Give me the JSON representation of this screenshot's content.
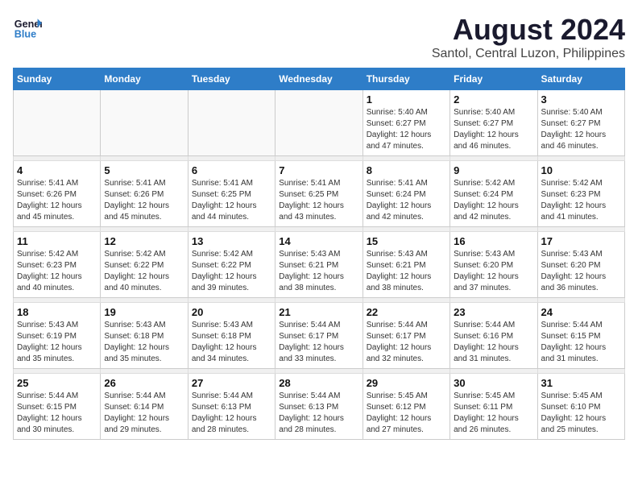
{
  "logo": {
    "line1": "General",
    "line2": "Blue"
  },
  "title": "August 2024",
  "subtitle": "Santol, Central Luzon, Philippines",
  "days_of_week": [
    "Sunday",
    "Monday",
    "Tuesday",
    "Wednesday",
    "Thursday",
    "Friday",
    "Saturday"
  ],
  "weeks": [
    {
      "days": [
        {
          "date": "",
          "info": ""
        },
        {
          "date": "",
          "info": ""
        },
        {
          "date": "",
          "info": ""
        },
        {
          "date": "",
          "info": ""
        },
        {
          "date": "1",
          "info": "Sunrise: 5:40 AM\nSunset: 6:27 PM\nDaylight: 12 hours\nand 47 minutes."
        },
        {
          "date": "2",
          "info": "Sunrise: 5:40 AM\nSunset: 6:27 PM\nDaylight: 12 hours\nand 46 minutes."
        },
        {
          "date": "3",
          "info": "Sunrise: 5:40 AM\nSunset: 6:27 PM\nDaylight: 12 hours\nand 46 minutes."
        }
      ]
    },
    {
      "days": [
        {
          "date": "4",
          "info": "Sunrise: 5:41 AM\nSunset: 6:26 PM\nDaylight: 12 hours\nand 45 minutes."
        },
        {
          "date": "5",
          "info": "Sunrise: 5:41 AM\nSunset: 6:26 PM\nDaylight: 12 hours\nand 45 minutes."
        },
        {
          "date": "6",
          "info": "Sunrise: 5:41 AM\nSunset: 6:25 PM\nDaylight: 12 hours\nand 44 minutes."
        },
        {
          "date": "7",
          "info": "Sunrise: 5:41 AM\nSunset: 6:25 PM\nDaylight: 12 hours\nand 43 minutes."
        },
        {
          "date": "8",
          "info": "Sunrise: 5:41 AM\nSunset: 6:24 PM\nDaylight: 12 hours\nand 42 minutes."
        },
        {
          "date": "9",
          "info": "Sunrise: 5:42 AM\nSunset: 6:24 PM\nDaylight: 12 hours\nand 42 minutes."
        },
        {
          "date": "10",
          "info": "Sunrise: 5:42 AM\nSunset: 6:23 PM\nDaylight: 12 hours\nand 41 minutes."
        }
      ]
    },
    {
      "days": [
        {
          "date": "11",
          "info": "Sunrise: 5:42 AM\nSunset: 6:23 PM\nDaylight: 12 hours\nand 40 minutes."
        },
        {
          "date": "12",
          "info": "Sunrise: 5:42 AM\nSunset: 6:22 PM\nDaylight: 12 hours\nand 40 minutes."
        },
        {
          "date": "13",
          "info": "Sunrise: 5:42 AM\nSunset: 6:22 PM\nDaylight: 12 hours\nand 39 minutes."
        },
        {
          "date": "14",
          "info": "Sunrise: 5:43 AM\nSunset: 6:21 PM\nDaylight: 12 hours\nand 38 minutes."
        },
        {
          "date": "15",
          "info": "Sunrise: 5:43 AM\nSunset: 6:21 PM\nDaylight: 12 hours\nand 38 minutes."
        },
        {
          "date": "16",
          "info": "Sunrise: 5:43 AM\nSunset: 6:20 PM\nDaylight: 12 hours\nand 37 minutes."
        },
        {
          "date": "17",
          "info": "Sunrise: 5:43 AM\nSunset: 6:20 PM\nDaylight: 12 hours\nand 36 minutes."
        }
      ]
    },
    {
      "days": [
        {
          "date": "18",
          "info": "Sunrise: 5:43 AM\nSunset: 6:19 PM\nDaylight: 12 hours\nand 35 minutes."
        },
        {
          "date": "19",
          "info": "Sunrise: 5:43 AM\nSunset: 6:18 PM\nDaylight: 12 hours\nand 35 minutes."
        },
        {
          "date": "20",
          "info": "Sunrise: 5:43 AM\nSunset: 6:18 PM\nDaylight: 12 hours\nand 34 minutes."
        },
        {
          "date": "21",
          "info": "Sunrise: 5:44 AM\nSunset: 6:17 PM\nDaylight: 12 hours\nand 33 minutes."
        },
        {
          "date": "22",
          "info": "Sunrise: 5:44 AM\nSunset: 6:17 PM\nDaylight: 12 hours\nand 32 minutes."
        },
        {
          "date": "23",
          "info": "Sunrise: 5:44 AM\nSunset: 6:16 PM\nDaylight: 12 hours\nand 31 minutes."
        },
        {
          "date": "24",
          "info": "Sunrise: 5:44 AM\nSunset: 6:15 PM\nDaylight: 12 hours\nand 31 minutes."
        }
      ]
    },
    {
      "days": [
        {
          "date": "25",
          "info": "Sunrise: 5:44 AM\nSunset: 6:15 PM\nDaylight: 12 hours\nand 30 minutes."
        },
        {
          "date": "26",
          "info": "Sunrise: 5:44 AM\nSunset: 6:14 PM\nDaylight: 12 hours\nand 29 minutes."
        },
        {
          "date": "27",
          "info": "Sunrise: 5:44 AM\nSunset: 6:13 PM\nDaylight: 12 hours\nand 28 minutes."
        },
        {
          "date": "28",
          "info": "Sunrise: 5:44 AM\nSunset: 6:13 PM\nDaylight: 12 hours\nand 28 minutes."
        },
        {
          "date": "29",
          "info": "Sunrise: 5:45 AM\nSunset: 6:12 PM\nDaylight: 12 hours\nand 27 minutes."
        },
        {
          "date": "30",
          "info": "Sunrise: 5:45 AM\nSunset: 6:11 PM\nDaylight: 12 hours\nand 26 minutes."
        },
        {
          "date": "31",
          "info": "Sunrise: 5:45 AM\nSunset: 6:10 PM\nDaylight: 12 hours\nand 25 minutes."
        }
      ]
    }
  ]
}
